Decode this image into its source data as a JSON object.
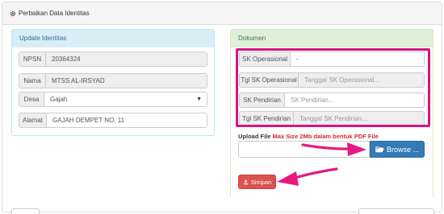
{
  "page": {
    "title": "Perbaikan Data Identitas"
  },
  "left_panel": {
    "title": "Update Identitas",
    "fields": [
      {
        "label": "NPSN",
        "value": "20364324"
      },
      {
        "label": "Nama",
        "value": "MTSS AL-IRSYAD"
      },
      {
        "label": "Desa",
        "value": "Gajah"
      },
      {
        "label": "Alamat",
        "value": "GAJAH DEMPET NO. 11"
      }
    ]
  },
  "right_panel": {
    "title": "Dokumen",
    "fields": [
      {
        "label": "SK Operasional",
        "value": "-",
        "placeholder": ""
      },
      {
        "label": "Tgl SK Operasional",
        "value": "",
        "placeholder": "Tanggal SK Operasional..."
      },
      {
        "label": "SK Pendirian",
        "value": "",
        "placeholder": "SK Pendirian..."
      },
      {
        "label": "Tgl SK Pendirian",
        "value": "",
        "placeholder": "Tanggal SK Pendirian..."
      }
    ],
    "upload": {
      "label": "Upload File",
      "warning": "Max Size 2Mb dalam bentuk PDF File",
      "browse_label": "Browse ..."
    },
    "save_label": "Simpan"
  },
  "colors": {
    "annotation": "#d6157f",
    "primary": "#337ab7",
    "danger": "#d9534f"
  },
  "icons": [
    "gear-icon",
    "folder-open-icon",
    "upload-icon",
    "chevron-down-icon",
    "arrow-annotation"
  ]
}
